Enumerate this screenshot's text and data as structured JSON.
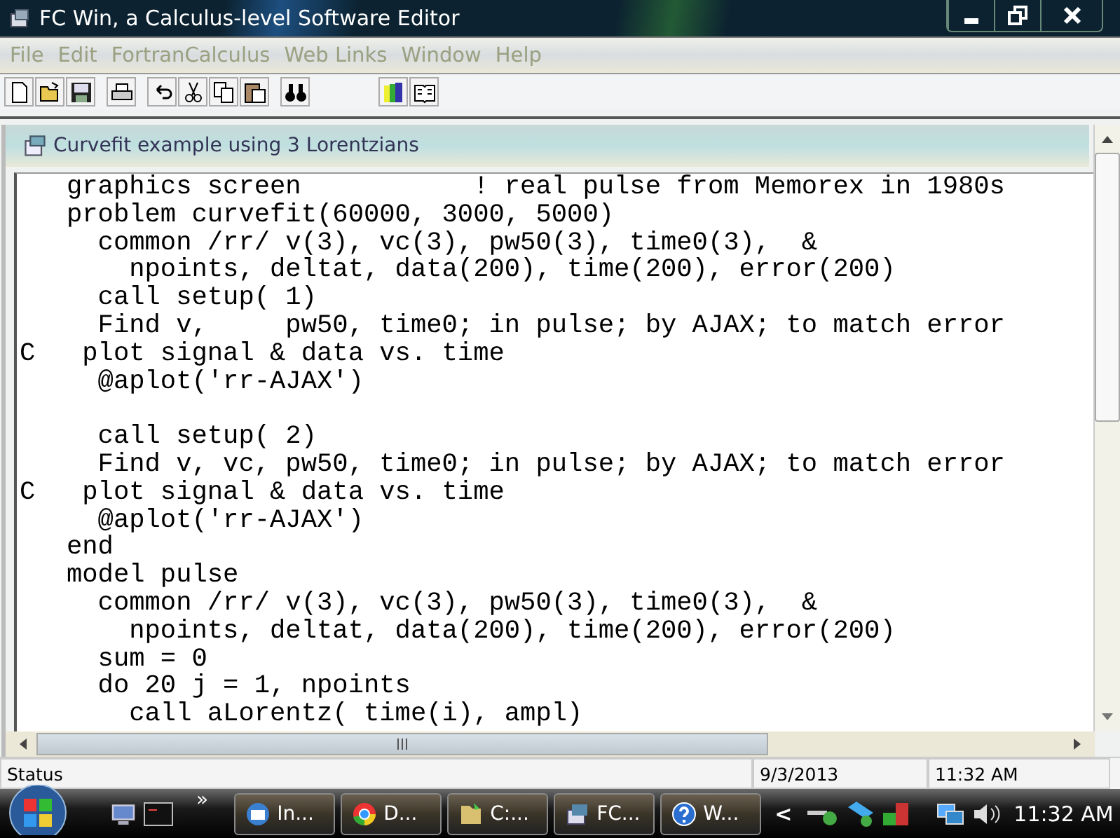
{
  "window": {
    "title": "FC Win, a Calculus-level Software Editor"
  },
  "menu": [
    "File",
    "Edit",
    "FortranCalculus",
    "Web Links",
    "Window",
    "Help"
  ],
  "toolbar": [
    {
      "kind": "new"
    },
    {
      "kind": "open"
    },
    {
      "kind": "save"
    },
    {
      "kind": "gap"
    },
    {
      "kind": "print"
    },
    {
      "kind": "gap"
    },
    {
      "kind": "undo"
    },
    {
      "kind": "cut"
    },
    {
      "kind": "copy"
    },
    {
      "kind": "paste"
    },
    {
      "kind": "gap"
    },
    {
      "kind": "find"
    },
    {
      "kind": "wide"
    },
    {
      "kind": "books"
    },
    {
      "kind": "book"
    }
  ],
  "document": {
    "title": "Curvefit example using 3 Lorentzians",
    "lines": [
      {
        "text": "   graphics screen           ! real pulse from Memorex in 1980s"
      },
      {
        "text": "   problem curvefit(60000, 3000, 5000)"
      },
      {
        "text": "     common /rr/ v(3), vc(3), pw50(3), time0(3),  &"
      },
      {
        "text": "       npoints, deltat, data(200), time(200), error(200)"
      },
      {
        "text": "     call setup( 1)"
      },
      {
        "text": "     Find v,     pw50, time0; in pulse; by AJAX; to match error"
      },
      {
        "text": "C   plot signal & data vs. time"
      },
      {
        "text": "     @aplot('rr-AJAX')"
      },
      {
        "text": "     call setup( 2)",
        "gap_before": true
      },
      {
        "text": "     Find v, vc, pw50, time0; in pulse; by AJAX; to match error"
      },
      {
        "text": "C   plot signal & data vs. time"
      },
      {
        "text": "     @aplot('rr-AJAX')"
      },
      {
        "text": "   end"
      },
      {
        "text": "   model pulse"
      },
      {
        "text": "     common /rr/ v(3), vc(3), pw50(3), time0(3),  &"
      },
      {
        "text": "       npoints, deltat, data(200), time(200), error(200)"
      },
      {
        "text": "     sum = 0"
      },
      {
        "text": "     do 20 j = 1, npoints"
      },
      {
        "text": "       call aLorentz( time(i), ampl)"
      }
    ]
  },
  "status_bar": {
    "text": "Status",
    "date": "9/3/2013",
    "time": "11:32 AM"
  },
  "taskbar": {
    "more": "»",
    "buttons": [
      {
        "label": "In...",
        "kind": "mail"
      },
      {
        "label": "D...",
        "kind": "chrome"
      },
      {
        "label": "C:...",
        "kind": "folder"
      },
      {
        "label": "FC...",
        "kind": "app"
      },
      {
        "label": "W...",
        "kind": "help"
      }
    ],
    "tray_arrow": "<",
    "clock": "11:32 AM"
  }
}
